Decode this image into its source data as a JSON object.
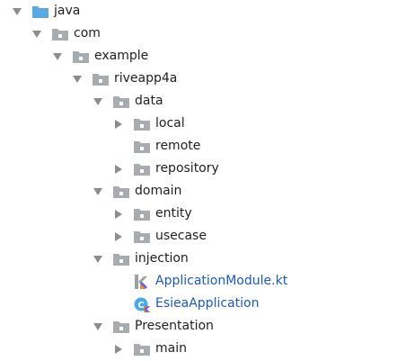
{
  "tree": {
    "java": "java",
    "com": "com",
    "example": "example",
    "riveapp4a": "riveapp4a",
    "data": "data",
    "local": "local",
    "remote": "remote",
    "repository": "repository",
    "domain": "domain",
    "entity": "entity",
    "usecase": "usecase",
    "injection": "injection",
    "application_module": "ApplicationModule.kt",
    "esiea_application": "EsieaApplication",
    "presentation": "Presentation",
    "main": "main"
  },
  "colors": {
    "source_folder": "#5aa8e0",
    "package_folder": "#a8acb1",
    "file_text": "#1c5ab8",
    "arrow": "#8c8c8c"
  },
  "icons": {
    "expanded": "triangle-down",
    "collapsed": "triangle-right",
    "package": "package-folder-icon",
    "source_root": "source-root-folder-icon",
    "kotlin_file": "kotlin-file-icon",
    "kotlin_class": "kotlin-class-icon"
  }
}
